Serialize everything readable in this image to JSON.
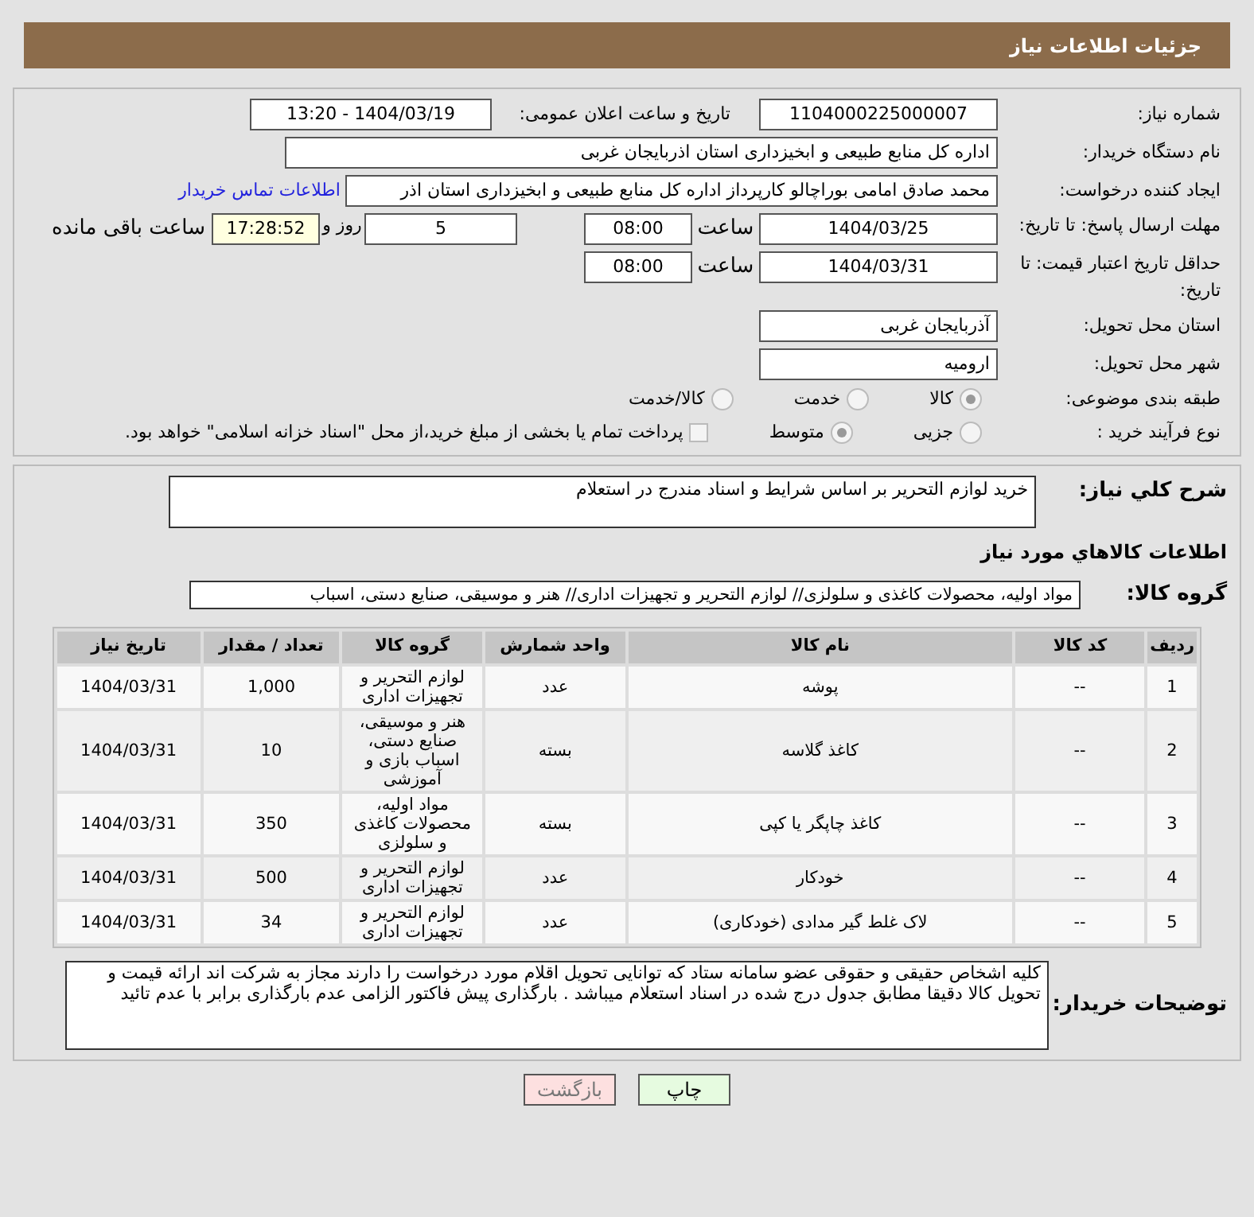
{
  "header": {
    "title": "جزئیات اطلاعات نیاز"
  },
  "need_number": {
    "label": "شماره نیاز:",
    "value": "1104000225000007"
  },
  "announce": {
    "label": "تاریخ و ساعت اعلان عمومی:",
    "value": "1404/03/19 - 13:20"
  },
  "buyer_org": {
    "label": "نام دستگاه خریدار:",
    "value": "اداره کل منابع طبیعی و ابخیزداری استان اذربایجان غربی"
  },
  "requester": {
    "label": "ایجاد کننده درخواست:",
    "value": "محمد صادق امامی بوراچالو کارپرداز اداره کل منابع طبیعی و ابخیزداری استان اذر",
    "link": "اطلاعات تماس خریدار"
  },
  "response_deadline": {
    "label": "مهلت ارسال پاسخ: تا تاریخ:",
    "date": "1404/03/25",
    "time_label": "ساعت",
    "time": "08:00",
    "days": "5",
    "days_label": "روز و",
    "remaining": "17:28:52",
    "remaining_label": "ساعت باقی مانده"
  },
  "price_validity": {
    "label": "حداقل تاریخ اعتبار قیمت: تا تاریخ:",
    "date": "1404/03/31",
    "time_label": "ساعت",
    "time": "08:00"
  },
  "delivery_province": {
    "label": "استان محل تحویل:",
    "value": "آذربایجان غربی"
  },
  "delivery_city": {
    "label": "شهر محل تحویل:",
    "value": "ارومیه"
  },
  "category": {
    "label": "طبقه بندی موضوعی:",
    "options": [
      {
        "label": "کالا",
        "selected": true
      },
      {
        "label": "خدمت",
        "selected": false
      },
      {
        "label": "کالا/خدمت",
        "selected": false
      }
    ]
  },
  "process": {
    "label": "نوع فرآیند خرید :",
    "options": [
      {
        "label": "جزیی",
        "selected": false
      },
      {
        "label": "متوسط",
        "selected": true
      }
    ],
    "payment_note": {
      "label": "پرداخت تمام یا بخشی از مبلغ خرید،از محل \"اسناد خزانه اسلامی\" خواهد بود.",
      "checked": false
    }
  },
  "summary": {
    "label": "شرح کلي نياز:",
    "value": "خرید لوازم التحریر بر اساس شرایط و اسناد مندرج در استعلام"
  },
  "goods_title": "اطلاعات کالاهاي مورد نياز",
  "goods_group": {
    "label": "گروه کالا:",
    "value": "مواد اولیه، محصولات کاغذی و سلولزی// لوازم التحریر و تجهیزات اداری// هنر و موسیقی، صنایع دستی، اسباب"
  },
  "table": {
    "columns": [
      "ردیف",
      "کد کالا",
      "نام کالا",
      "واحد شمارش",
      "گروه کالا",
      "تعداد / مقدار",
      "تاریخ نیاز"
    ],
    "rows": [
      [
        "1",
        "--",
        "پوشه",
        "عدد",
        "لوازم التحریر و تجهیزات اداری",
        "1,000",
        "1404/03/31"
      ],
      [
        "2",
        "--",
        "کاغذ گلاسه",
        "بسته",
        "هنر و موسیقی، صنایع دستی، اسباب بازی و آموزشی",
        "10",
        "1404/03/31"
      ],
      [
        "3",
        "--",
        "کاغذ چاپگر یا کپی",
        "بسته",
        "مواد اولیه، محصولات کاغذی و سلولزی",
        "350",
        "1404/03/31"
      ],
      [
        "4",
        "--",
        "خودکار",
        "عدد",
        "لوازم التحریر و تجهیزات اداری",
        "500",
        "1404/03/31"
      ],
      [
        "5",
        "--",
        "لاک غلط گیر مدادی (خودکاری)",
        "عدد",
        "لوازم التحریر و تجهیزات اداری",
        "34",
        "1404/03/31"
      ]
    ]
  },
  "buyer_notes": {
    "label": "توضیحات خریدار:",
    "value": "کلیه اشخاص حقیقی و حقوقی عضو سامانه ستاد که توانایی تحویل اقلام مورد درخواست را دارند مجاز به شرکت اند ارائه قیمت و تحویل کالا دقیقا مطابق جدول درج شده در اسناد استعلام میباشد . بارگذاری پیش فاکتور الزامی عدم بارگذاری برابر با عدم تائید"
  },
  "buttons": [
    {
      "label": "چاپ",
      "kind": "print"
    },
    {
      "label": "بازگشت",
      "kind": "back"
    }
  ]
}
